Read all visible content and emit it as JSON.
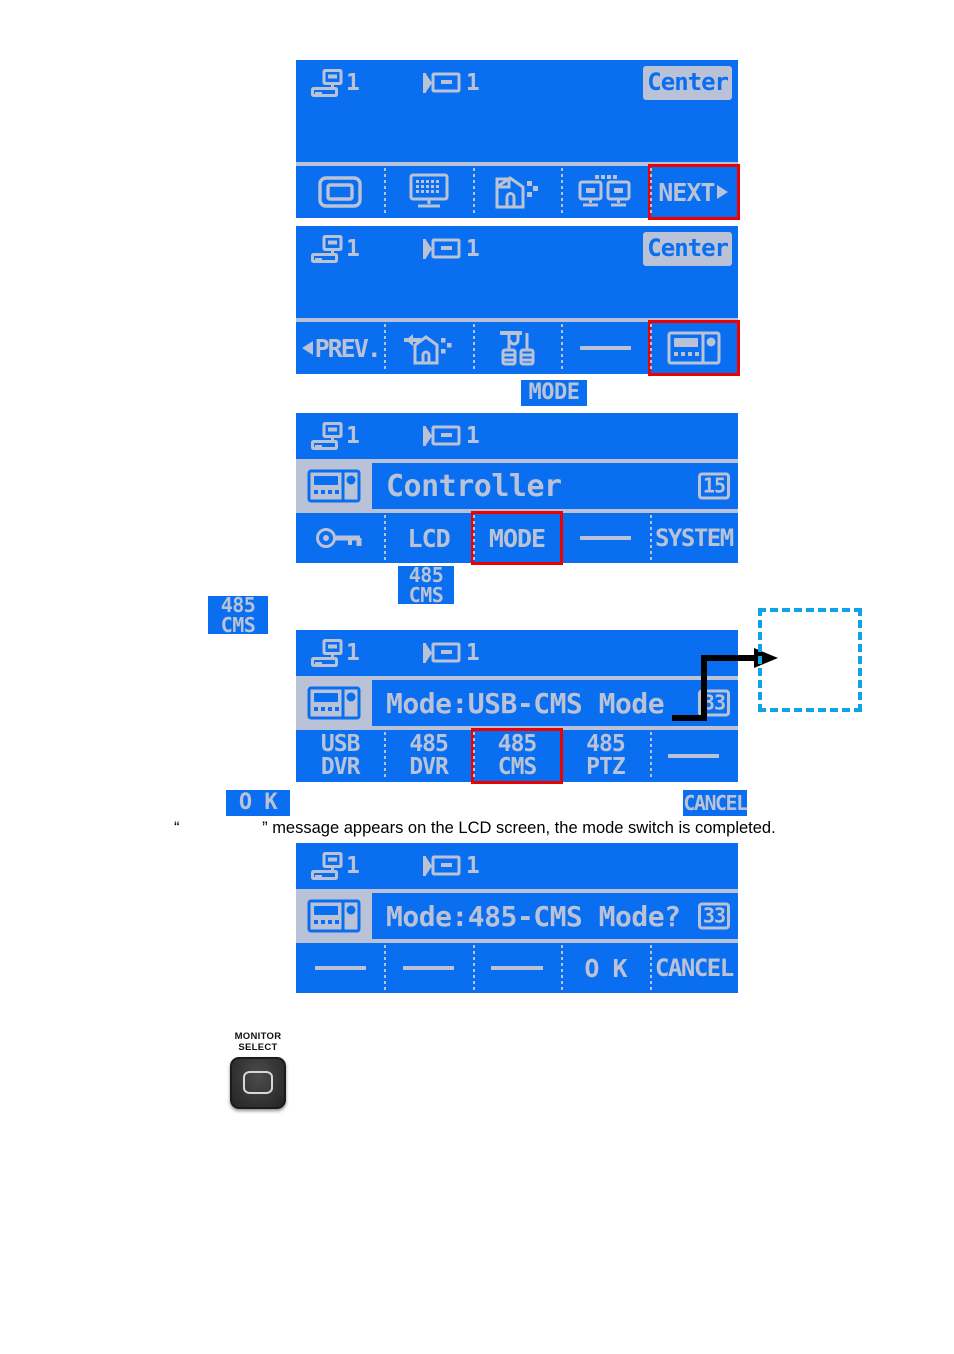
{
  "panels": [
    {
      "id": "lcd-panel-main-next",
      "status": {
        "monitor_num": "1",
        "camera_num": "1",
        "center_label": "Center"
      },
      "softkeys": [
        {
          "name": "monitor-icon-key",
          "type": "icon",
          "icon": "monitor-icon",
          "label": ""
        },
        {
          "name": "keyboard-icon-key",
          "type": "icon",
          "icon": "keyboard-monitor-icon",
          "label": ""
        },
        {
          "name": "site-icon-key",
          "type": "icon",
          "icon": "site-alarm-icon",
          "label": ""
        },
        {
          "name": "dual-monitor-icon-key",
          "type": "icon",
          "icon": "dual-monitor-icon",
          "label": ""
        },
        {
          "name": "next-key",
          "type": "text",
          "icon": "arrow-right-icon",
          "label": "NEXT",
          "highlight": true
        }
      ]
    },
    {
      "id": "lcd-panel-prev-controller",
      "status": {
        "monitor_num": "1",
        "camera_num": "1",
        "center_label": "Center"
      },
      "softkeys": [
        {
          "name": "prev-key",
          "type": "text",
          "icon": "arrow-left-icon",
          "label": "PREV."
        },
        {
          "name": "alarm-out-icon-key",
          "type": "icon",
          "icon": "alarm-out-icon",
          "label": ""
        },
        {
          "name": "tools-icon-key",
          "type": "icon",
          "icon": "tools-setup-icon",
          "label": ""
        },
        {
          "name": "empty-key",
          "type": "dash",
          "icon": "",
          "label": ""
        },
        {
          "name": "controller-key",
          "type": "icon",
          "icon": "controller-icon",
          "label": "",
          "highlight": true
        }
      ]
    },
    {
      "id": "lcd-panel-controller-menu",
      "status": {
        "monitor_num": "1",
        "camera_num": "1",
        "center_label": ""
      },
      "menu": {
        "icon": "controller-icon",
        "text": "Controller",
        "badge": "15"
      },
      "softkeys": [
        {
          "name": "key-lock-key",
          "type": "icon",
          "icon": "key-icon",
          "label": ""
        },
        {
          "name": "lcd-key",
          "type": "text",
          "icon": "",
          "label": "LCD"
        },
        {
          "name": "mode-key",
          "type": "text",
          "icon": "",
          "label": "MODE",
          "highlight": true
        },
        {
          "name": "empty-key",
          "type": "dash",
          "icon": "",
          "label": ""
        },
        {
          "name": "system-key",
          "type": "text",
          "icon": "",
          "label": "SYSTEM"
        }
      ]
    },
    {
      "id": "lcd-panel-mode-select",
      "status": {
        "monitor_num": "1",
        "camera_num": "1",
        "center_label": ""
      },
      "menu": {
        "icon": "controller-icon",
        "text": "Mode:USB-CMS Mode",
        "badge": "33"
      },
      "softkeys": [
        {
          "name": "usb-dvr-key",
          "type": "text2",
          "line1": "USB",
          "line2": "DVR"
        },
        {
          "name": "485-dvr-key",
          "type": "text2",
          "line1": "485",
          "line2": "DVR"
        },
        {
          "name": "485-cms-key",
          "type": "text2",
          "line1": "485",
          "line2": "CMS",
          "highlight": true
        },
        {
          "name": "485-ptz-key",
          "type": "text2",
          "line1": "485",
          "line2": "PTZ"
        },
        {
          "name": "empty-key",
          "type": "dash",
          "line1": "",
          "line2": ""
        }
      ]
    },
    {
      "id": "lcd-panel-mode-confirm",
      "status": {
        "monitor_num": "1",
        "camera_num": "1",
        "center_label": ""
      },
      "menu": {
        "icon": "controller-icon",
        "text": "Mode:485-CMS Mode?",
        "badge": "33"
      },
      "softkeys": [
        {
          "name": "empty-key-1",
          "type": "dash",
          "label": ""
        },
        {
          "name": "empty-key-2",
          "type": "dash",
          "label": ""
        },
        {
          "name": "empty-key-3",
          "type": "dash",
          "label": ""
        },
        {
          "name": "ok-key",
          "type": "text",
          "label": "O K"
        },
        {
          "name": "cancel-key",
          "type": "text",
          "label": "CANCEL"
        }
      ]
    }
  ],
  "badges": {
    "mode": "MODE",
    "cms_left_l1": "485",
    "cms_left_l2": "CMS",
    "cms_mid_l1": "485",
    "cms_mid_l2": "CMS",
    "ok": "O K",
    "cancel": "CANCEL"
  },
  "caption": {
    "open_quote": "“",
    "close_quote": "”",
    "text": "message appears on the LCD screen, the mode switch is completed."
  },
  "hardware_button": {
    "label_line1": "MONITOR",
    "label_line2": "SELECT",
    "glyph": "rounded-rect-icon"
  },
  "colors": {
    "lcd_background": "#0a6ef0",
    "lcd_foreground": "#b9c2d6",
    "highlight_red": "#ee0000",
    "callout_cyan": "#11a3e8",
    "callout_black": "#000000"
  }
}
